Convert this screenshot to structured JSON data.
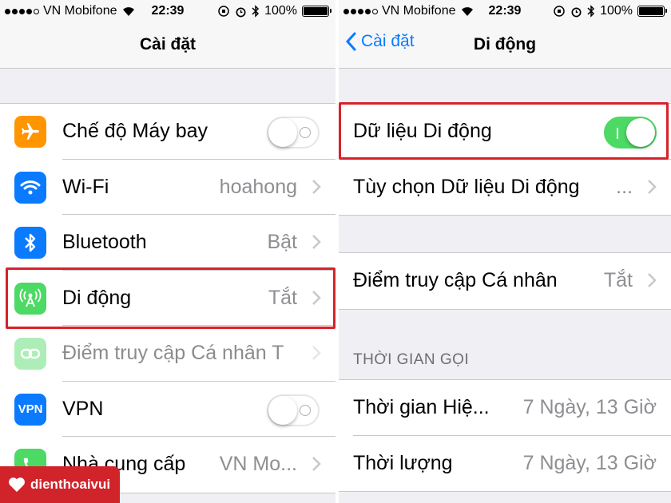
{
  "left": {
    "status": {
      "carrier": "VN Mobifone",
      "time": "22:39",
      "battery": "100%"
    },
    "nav_title": "Cài đặt",
    "rows": [
      {
        "label": "Chế độ Máy bay",
        "value": "",
        "icon": "airplane-icon",
        "color": "#ff9500",
        "accessory": "toggle-off"
      },
      {
        "label": "Wi-Fi",
        "value": "hoahong",
        "icon": "wifi-icon",
        "color": "#0a7aff",
        "accessory": "chevron"
      },
      {
        "label": "Bluetooth",
        "value": "Bật",
        "icon": "bluetooth-icon",
        "color": "#0a7aff",
        "accessory": "chevron"
      },
      {
        "label": "Di động",
        "value": "Tắt",
        "icon": "cellular-icon",
        "color": "#4cd964",
        "accessory": "chevron"
      },
      {
        "label": "Điểm truy cập Cá nhân T",
        "value": "",
        "icon": "hotspot-icon",
        "color": "#4cd964",
        "accessory": "chevron"
      },
      {
        "label": "VPN",
        "value": "",
        "icon": "vpn-icon",
        "icon_text": "VPN",
        "color": "#0a7aff",
        "accessory": "toggle-off"
      },
      {
        "label": "Nhà cung cấp",
        "value": "VN Mo...",
        "icon": "phone-icon",
        "color": "#4cd964",
        "accessory": "chevron"
      }
    ]
  },
  "right": {
    "status": {
      "carrier": "VN Mobifone",
      "time": "22:39",
      "battery": "100%"
    },
    "back_label": "Cài đặt",
    "nav_title": "Di động",
    "group1": [
      {
        "label": "Dữ liệu Di động",
        "accessory": "toggle-on"
      },
      {
        "label": "Tùy chọn Dữ liệu Di động",
        "value": "...",
        "accessory": "chevron"
      }
    ],
    "group2": [
      {
        "label": "Điểm truy cập Cá nhân",
        "value": "Tắt",
        "accessory": "chevron"
      }
    ],
    "section_header": "THỜI GIAN GỌI",
    "group3": [
      {
        "label": "Thời gian Hiệ...",
        "value": "7 Ngày, 13 Giờ"
      },
      {
        "label": "Thời lượng",
        "value": "7 Ngày, 13 Giờ"
      }
    ]
  },
  "watermark": "dienthoaivui",
  "colors": {
    "highlight": "#d8222a",
    "ios_blue": "#0a7aff",
    "ios_green": "#4cd964"
  }
}
